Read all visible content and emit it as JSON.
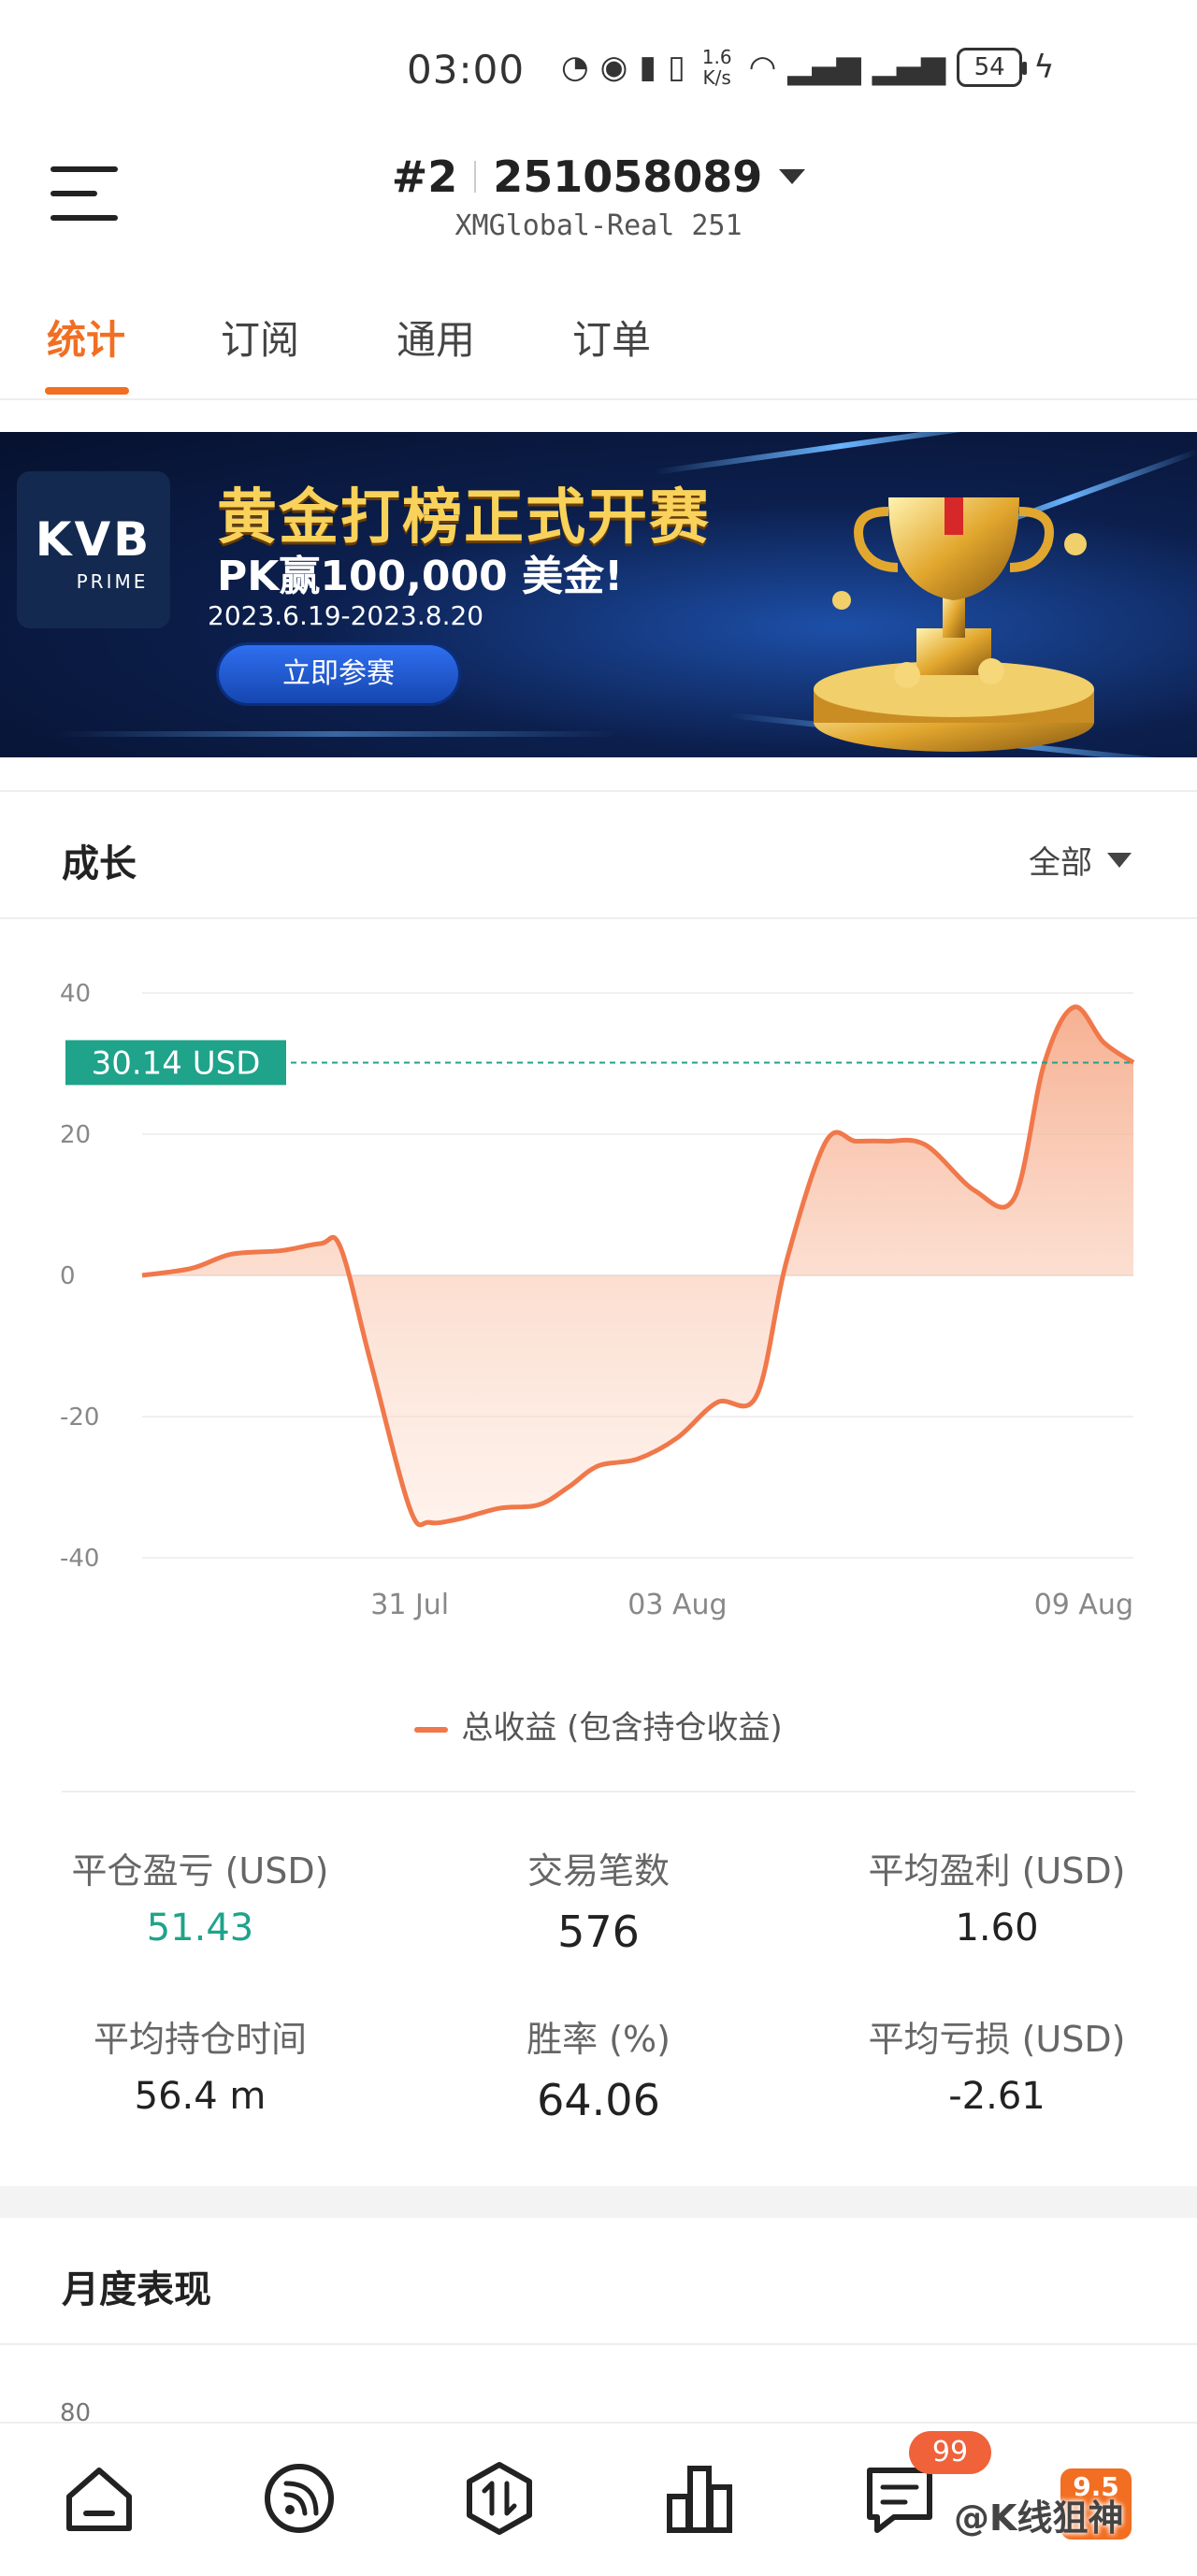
{
  "status_bar": {
    "time": "03:00",
    "speed_value": "1.6",
    "speed_unit": "K/s",
    "battery": "54"
  },
  "header": {
    "account_rank": "#2",
    "account_number": "251058089",
    "server": "XMGlobal-Real 251"
  },
  "tabs": [
    {
      "label": "统计",
      "active": true
    },
    {
      "label": "订阅",
      "active": false
    },
    {
      "label": "通用",
      "active": false
    },
    {
      "label": "订单",
      "active": false
    }
  ],
  "banner": {
    "logo_main": "KVB",
    "logo_sub": "PRIME",
    "title": "黄金打榜正式开赛",
    "subtitle": "PK赢100,000 美金!",
    "dates": "2023.6.19-2023.8.20",
    "button": "立即参赛"
  },
  "growth": {
    "title": "成长",
    "range": "全部",
    "current_tag": "30.14 USD",
    "legend": "总收益 (包含持仓收益)"
  },
  "chart_data": {
    "type": "area",
    "title": "",
    "xlabel": "",
    "ylabel": "",
    "ylim": [
      -40,
      40
    ],
    "y_ticks": [
      40,
      20,
      0,
      -20,
      -40
    ],
    "x_ticks": [
      "31 Jul",
      "03 Aug",
      "09 Aug"
    ],
    "reference_line": {
      "value": 30.14,
      "label": "30.14 USD"
    },
    "series": [
      {
        "name": "总收益 (包含持仓收益)",
        "color": "#f0784a",
        "x": [
          0,
          0.05,
          0.09,
          0.14,
          0.18,
          0.2,
          0.23,
          0.27,
          0.29,
          0.32,
          0.36,
          0.4,
          0.43,
          0.46,
          0.5,
          0.54,
          0.58,
          0.62,
          0.65,
          0.69,
          0.72,
          0.75,
          0.79,
          0.84,
          0.88,
          0.91,
          0.94,
          0.97,
          1.0
        ],
        "values": [
          0,
          1,
          3,
          3.5,
          4.5,
          4,
          -12,
          -33,
          -35,
          -34.5,
          -33,
          -32.5,
          -30,
          -27,
          -26,
          -23,
          -18,
          -17,
          2,
          19,
          19,
          19,
          18.5,
          12,
          11,
          30,
          38,
          33,
          30.14
        ]
      }
    ]
  },
  "stats": [
    {
      "label": "平仓盈亏 (USD)",
      "value": "51.43",
      "highlight": true
    },
    {
      "label": "交易笔数",
      "value": "576",
      "highlight": false
    },
    {
      "label": "平均盈利 (USD)",
      "value": "1.60",
      "highlight": false
    },
    {
      "label": "平均持仓时间",
      "value": "56.4 m",
      "highlight": false
    },
    {
      "label": "胜率 (%)",
      "value": "64.06",
      "highlight": false
    },
    {
      "label": "平均亏损 (USD)",
      "value": "-2.61",
      "highlight": false
    }
  ],
  "monthly": {
    "title": "月度表现",
    "first_tick": "80"
  },
  "bottom_nav": {
    "items": [
      "home-icon",
      "feed-icon",
      "trade-icon",
      "chart-bar-icon",
      "message-icon"
    ],
    "message_badge": "99",
    "tile_text": "9.5",
    "watermark": "@K线狙神"
  },
  "colors": {
    "accent": "#f26e22",
    "positive": "#1fa38a",
    "line": "#f0784a",
    "reference": "#1fa38a"
  }
}
